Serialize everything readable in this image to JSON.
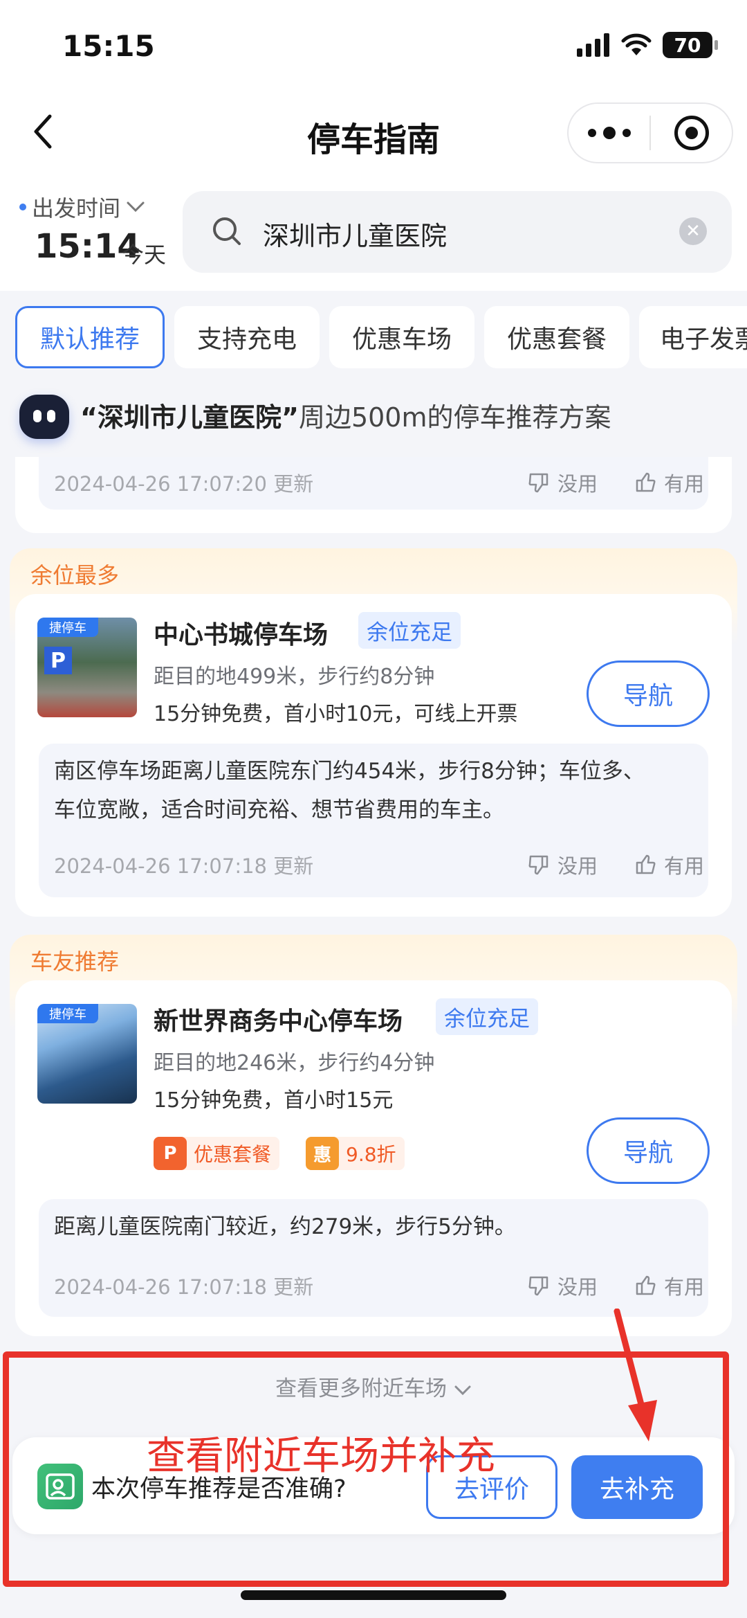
{
  "status_bar": {
    "time": "15:15",
    "battery": "70"
  },
  "nav": {
    "title": "停车指南"
  },
  "departure": {
    "label": "出发时间",
    "time": "15:14",
    "day": "今天"
  },
  "search": {
    "query": "深圳市儿童医院"
  },
  "tabs": [
    {
      "label": "默认推荐",
      "active": true
    },
    {
      "label": "支持充电"
    },
    {
      "label": "优惠车场"
    },
    {
      "label": "优惠套餐"
    },
    {
      "label": "电子发票"
    }
  ],
  "hint": {
    "place": "“深圳市儿童医院”",
    "rest": "周边500m的停车推荐方案"
  },
  "prev_card": {
    "updated": "2024-04-26 17:07:20 更新",
    "useless": "没用",
    "useful": "有用"
  },
  "sections": [
    {
      "title": "余位最多",
      "thumb_tag": "捷停车",
      "name": "中心书城停车场",
      "badge": "余位充足",
      "distance": "距目的地499米，步行约8分钟",
      "price": "15分钟免费，首小时10元，可线上开票",
      "nav_label": "导航",
      "desc_line1": "南区停车场距离儿童医院东门约454米，步行8分钟；车位多、",
      "desc_line2": "车位宽敞，适合时间充裕、想节省费用的车主。",
      "updated": "2024-04-26 17:07:18 更新",
      "useless": "没用",
      "useful": "有用"
    },
    {
      "title": "车友推荐",
      "thumb_tag": "捷停车",
      "name": "新世界商务中心停车场",
      "badge": "余位充足",
      "distance": "距目的地246米，步行约4分钟",
      "price": "15分钟免费，首小时15元",
      "promo1_icon": "P",
      "promo1": "优惠套餐",
      "promo2_icon": "惠",
      "promo2": "9.8折",
      "nav_label": "导航",
      "desc_line1": "距离儿童医院南门较近，约279米，步行5分钟。",
      "updated": "2024-04-26 17:07:18 更新",
      "useless": "没用",
      "useful": "有用"
    }
  ],
  "more_link": "查看更多附近车场",
  "feedback": {
    "question": "本次停车推荐是否准确?",
    "rate": "去评价",
    "supplement": "去补充"
  },
  "annotation": {
    "text": "查看附近车场并补充",
    "color": "#e8322a"
  },
  "colors": {
    "accent": "#3d79ef",
    "section_title": "#ef7b32"
  }
}
